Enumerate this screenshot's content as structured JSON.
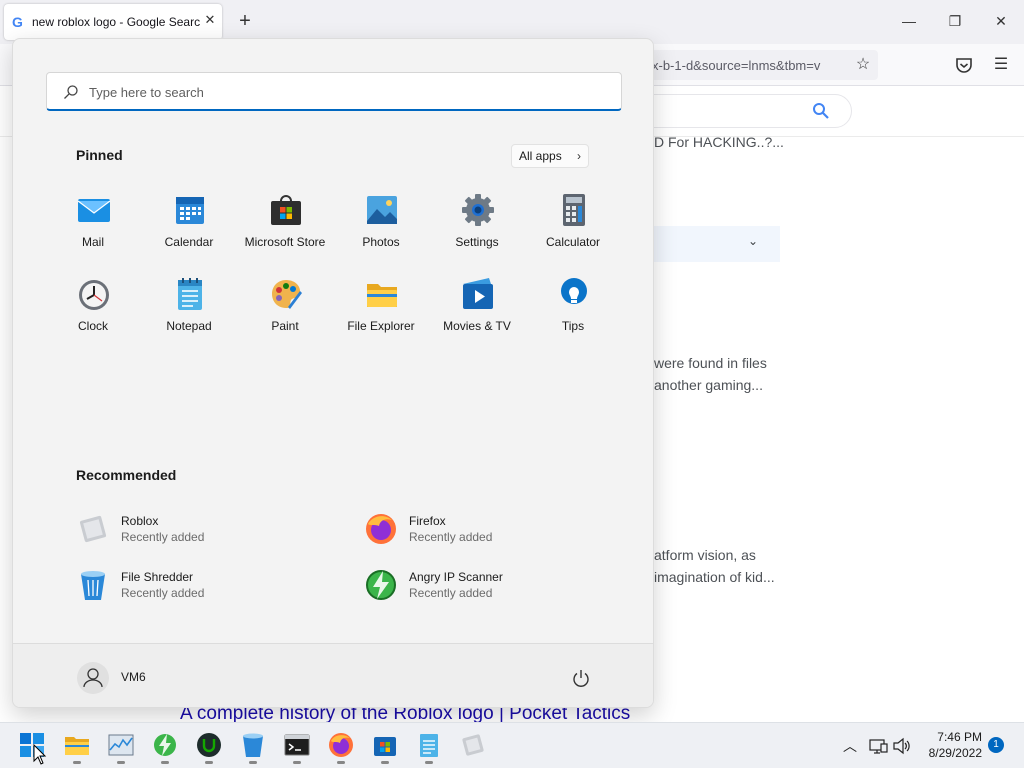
{
  "browser": {
    "tab_title": "new roblox logo - Google Search",
    "tab_favicon": "G",
    "url_fragment": "x-b-1-d&source=lnms&tbm=v",
    "new_tab": "+",
    "snippets": {
      "s1": "D For HACKING..?...",
      "s2": "were found in files",
      "s3": "another gaming...",
      "s4": "atform vision, as",
      "s5": "imagination of kid..."
    },
    "result_link": "A complete history of the Roblox logo | Pocket Tactics"
  },
  "start_menu": {
    "search_placeholder": "Type here to search",
    "pinned_title": "Pinned",
    "all_apps": "All apps",
    "pinned": [
      {
        "label": "Mail",
        "icon": "mail-icon"
      },
      {
        "label": "Calendar",
        "icon": "calendar-icon"
      },
      {
        "label": "Microsoft Store",
        "icon": "store-icon"
      },
      {
        "label": "Photos",
        "icon": "photos-icon"
      },
      {
        "label": "Settings",
        "icon": "settings-icon"
      },
      {
        "label": "Calculator",
        "icon": "calculator-icon"
      },
      {
        "label": "Clock",
        "icon": "clock-icon"
      },
      {
        "label": "Notepad",
        "icon": "notepad-icon"
      },
      {
        "label": "Paint",
        "icon": "paint-icon"
      },
      {
        "label": "File Explorer",
        "icon": "folder-icon"
      },
      {
        "label": "Movies & TV",
        "icon": "movies-icon"
      },
      {
        "label": "Tips",
        "icon": "tips-icon"
      }
    ],
    "recommended_title": "Recommended",
    "recommended": [
      {
        "name": "Roblox",
        "sub": "Recently added",
        "icon": "roblox-icon"
      },
      {
        "name": "Firefox",
        "sub": "Recently added",
        "icon": "firefox-icon"
      },
      {
        "name": "File Shredder",
        "sub": "Recently added",
        "icon": "shredder-icon"
      },
      {
        "name": "Angry IP Scanner",
        "sub": "Recently added",
        "icon": "ip-scanner-icon"
      }
    ],
    "user_name": "VM6"
  },
  "taskbar": {
    "apps": [
      "start-icon",
      "file-explorer-icon",
      "task-manager-icon",
      "ip-scanner-icon",
      "upwork-icon",
      "file-shredder-icon",
      "terminal-icon",
      "firefox-icon",
      "store-icon",
      "notepad-icon",
      "roblox-icon"
    ],
    "time": "7:46 PM",
    "date": "8/29/2022",
    "notifications": "1"
  },
  "colors": {
    "accent": "#0067c0",
    "start_bg": "#f3f3f3",
    "taskbar_bg": "#eef0f4",
    "link": "#1a0dab"
  }
}
